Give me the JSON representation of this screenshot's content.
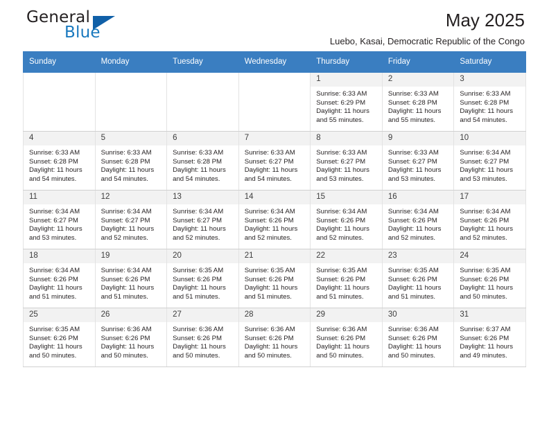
{
  "brand": {
    "name_top": "General",
    "name_bottom": "Blue",
    "accent_color": "#1060a8",
    "blue_text_color": "#1878be"
  },
  "header": {
    "title": "May 2025",
    "subtitle": "Luebo, Kasai, Democratic Republic of the Congo"
  },
  "theme": {
    "header_row_bg": "#3a7ec1",
    "header_row_text": "#ffffff",
    "daynum_bg": "#f2f2f2",
    "empty_cell_bg": "#f2f2f2",
    "cell_border": "#e3e3e3"
  },
  "calendar": {
    "weekdays": [
      "Sunday",
      "Monday",
      "Tuesday",
      "Wednesday",
      "Thursday",
      "Friday",
      "Saturday"
    ],
    "weeks": [
      [
        {
          "day": "",
          "lines": []
        },
        {
          "day": "",
          "lines": []
        },
        {
          "day": "",
          "lines": []
        },
        {
          "day": "",
          "lines": []
        },
        {
          "day": "1",
          "lines": [
            "Sunrise: 6:33 AM",
            "Sunset: 6:29 PM",
            "Daylight: 11 hours",
            "and 55 minutes."
          ]
        },
        {
          "day": "2",
          "lines": [
            "Sunrise: 6:33 AM",
            "Sunset: 6:28 PM",
            "Daylight: 11 hours",
            "and 55 minutes."
          ]
        },
        {
          "day": "3",
          "lines": [
            "Sunrise: 6:33 AM",
            "Sunset: 6:28 PM",
            "Daylight: 11 hours",
            "and 54 minutes."
          ]
        }
      ],
      [
        {
          "day": "4",
          "lines": [
            "Sunrise: 6:33 AM",
            "Sunset: 6:28 PM",
            "Daylight: 11 hours",
            "and 54 minutes."
          ]
        },
        {
          "day": "5",
          "lines": [
            "Sunrise: 6:33 AM",
            "Sunset: 6:28 PM",
            "Daylight: 11 hours",
            "and 54 minutes."
          ]
        },
        {
          "day": "6",
          "lines": [
            "Sunrise: 6:33 AM",
            "Sunset: 6:28 PM",
            "Daylight: 11 hours",
            "and 54 minutes."
          ]
        },
        {
          "day": "7",
          "lines": [
            "Sunrise: 6:33 AM",
            "Sunset: 6:27 PM",
            "Daylight: 11 hours",
            "and 54 minutes."
          ]
        },
        {
          "day": "8",
          "lines": [
            "Sunrise: 6:33 AM",
            "Sunset: 6:27 PM",
            "Daylight: 11 hours",
            "and 53 minutes."
          ]
        },
        {
          "day": "9",
          "lines": [
            "Sunrise: 6:33 AM",
            "Sunset: 6:27 PM",
            "Daylight: 11 hours",
            "and 53 minutes."
          ]
        },
        {
          "day": "10",
          "lines": [
            "Sunrise: 6:34 AM",
            "Sunset: 6:27 PM",
            "Daylight: 11 hours",
            "and 53 minutes."
          ]
        }
      ],
      [
        {
          "day": "11",
          "lines": [
            "Sunrise: 6:34 AM",
            "Sunset: 6:27 PM",
            "Daylight: 11 hours",
            "and 53 minutes."
          ]
        },
        {
          "day": "12",
          "lines": [
            "Sunrise: 6:34 AM",
            "Sunset: 6:27 PM",
            "Daylight: 11 hours",
            "and 52 minutes."
          ]
        },
        {
          "day": "13",
          "lines": [
            "Sunrise: 6:34 AM",
            "Sunset: 6:27 PM",
            "Daylight: 11 hours",
            "and 52 minutes."
          ]
        },
        {
          "day": "14",
          "lines": [
            "Sunrise: 6:34 AM",
            "Sunset: 6:26 PM",
            "Daylight: 11 hours",
            "and 52 minutes."
          ]
        },
        {
          "day": "15",
          "lines": [
            "Sunrise: 6:34 AM",
            "Sunset: 6:26 PM",
            "Daylight: 11 hours",
            "and 52 minutes."
          ]
        },
        {
          "day": "16",
          "lines": [
            "Sunrise: 6:34 AM",
            "Sunset: 6:26 PM",
            "Daylight: 11 hours",
            "and 52 minutes."
          ]
        },
        {
          "day": "17",
          "lines": [
            "Sunrise: 6:34 AM",
            "Sunset: 6:26 PM",
            "Daylight: 11 hours",
            "and 52 minutes."
          ]
        }
      ],
      [
        {
          "day": "18",
          "lines": [
            "Sunrise: 6:34 AM",
            "Sunset: 6:26 PM",
            "Daylight: 11 hours",
            "and 51 minutes."
          ]
        },
        {
          "day": "19",
          "lines": [
            "Sunrise: 6:34 AM",
            "Sunset: 6:26 PM",
            "Daylight: 11 hours",
            "and 51 minutes."
          ]
        },
        {
          "day": "20",
          "lines": [
            "Sunrise: 6:35 AM",
            "Sunset: 6:26 PM",
            "Daylight: 11 hours",
            "and 51 minutes."
          ]
        },
        {
          "day": "21",
          "lines": [
            "Sunrise: 6:35 AM",
            "Sunset: 6:26 PM",
            "Daylight: 11 hours",
            "and 51 minutes."
          ]
        },
        {
          "day": "22",
          "lines": [
            "Sunrise: 6:35 AM",
            "Sunset: 6:26 PM",
            "Daylight: 11 hours",
            "and 51 minutes."
          ]
        },
        {
          "day": "23",
          "lines": [
            "Sunrise: 6:35 AM",
            "Sunset: 6:26 PM",
            "Daylight: 11 hours",
            "and 51 minutes."
          ]
        },
        {
          "day": "24",
          "lines": [
            "Sunrise: 6:35 AM",
            "Sunset: 6:26 PM",
            "Daylight: 11 hours",
            "and 50 minutes."
          ]
        }
      ],
      [
        {
          "day": "25",
          "lines": [
            "Sunrise: 6:35 AM",
            "Sunset: 6:26 PM",
            "Daylight: 11 hours",
            "and 50 minutes."
          ]
        },
        {
          "day": "26",
          "lines": [
            "Sunrise: 6:36 AM",
            "Sunset: 6:26 PM",
            "Daylight: 11 hours",
            "and 50 minutes."
          ]
        },
        {
          "day": "27",
          "lines": [
            "Sunrise: 6:36 AM",
            "Sunset: 6:26 PM",
            "Daylight: 11 hours",
            "and 50 minutes."
          ]
        },
        {
          "day": "28",
          "lines": [
            "Sunrise: 6:36 AM",
            "Sunset: 6:26 PM",
            "Daylight: 11 hours",
            "and 50 minutes."
          ]
        },
        {
          "day": "29",
          "lines": [
            "Sunrise: 6:36 AM",
            "Sunset: 6:26 PM",
            "Daylight: 11 hours",
            "and 50 minutes."
          ]
        },
        {
          "day": "30",
          "lines": [
            "Sunrise: 6:36 AM",
            "Sunset: 6:26 PM",
            "Daylight: 11 hours",
            "and 50 minutes."
          ]
        },
        {
          "day": "31",
          "lines": [
            "Sunrise: 6:37 AM",
            "Sunset: 6:26 PM",
            "Daylight: 11 hours",
            "and 49 minutes."
          ]
        }
      ]
    ]
  }
}
